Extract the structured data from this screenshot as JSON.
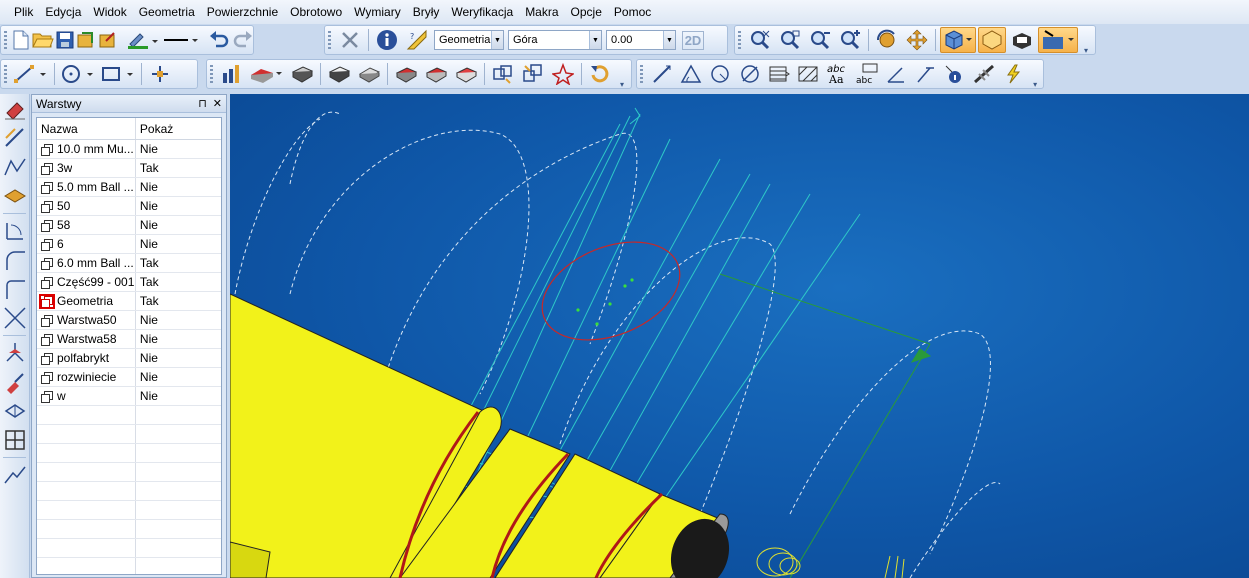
{
  "menu": [
    "Plik",
    "Edycja",
    "Widok",
    "Geometria",
    "Powierzchnie",
    "Obrotowo",
    "Wymiary",
    "Bryły",
    "Weryfikacja",
    "Makra",
    "Opcje",
    "Pomoc"
  ],
  "toolbar": {
    "layer_combo": "Geometria",
    "view_combo": "Góra",
    "depth_combo": "0.00",
    "mode_2d": "2D"
  },
  "panel": {
    "title": "Warstwy",
    "pin": "⊓",
    "close": "✕",
    "col_name": "Nazwa",
    "col_show": "Pokaż",
    "layers": [
      {
        "name": "10.0 mm Mu...",
        "show": "Nie",
        "active": false
      },
      {
        "name": "3w",
        "show": "Tak",
        "active": false
      },
      {
        "name": "5.0 mm Ball ...",
        "show": "Nie",
        "active": false
      },
      {
        "name": "50",
        "show": "Nie",
        "active": false
      },
      {
        "name": "58",
        "show": "Nie",
        "active": false
      },
      {
        "name": "6",
        "show": "Nie",
        "active": false
      },
      {
        "name": "6.0 mm Ball ...",
        "show": "Tak",
        "active": false
      },
      {
        "name": "Część99 - 001",
        "show": "Tak",
        "active": false
      },
      {
        "name": "Geometria",
        "show": "Tak",
        "active": true
      },
      {
        "name": "Warstwa50",
        "show": "Nie",
        "active": false
      },
      {
        "name": "Warstwa58",
        "show": "Nie",
        "active": false
      },
      {
        "name": "polfabrykt",
        "show": "Nie",
        "active": false
      },
      {
        "name": "rozwiniecie",
        "show": "Nie",
        "active": false
      },
      {
        "name": "w",
        "show": "Nie",
        "active": false
      }
    ]
  },
  "colors": {
    "viewport_bg": "#0f57a8",
    "part_yellow": "#f2f21a",
    "toolpath_cyan": "#2ec8c8",
    "highlight_red": "#c82828",
    "active_orange": "#f6b24a"
  }
}
